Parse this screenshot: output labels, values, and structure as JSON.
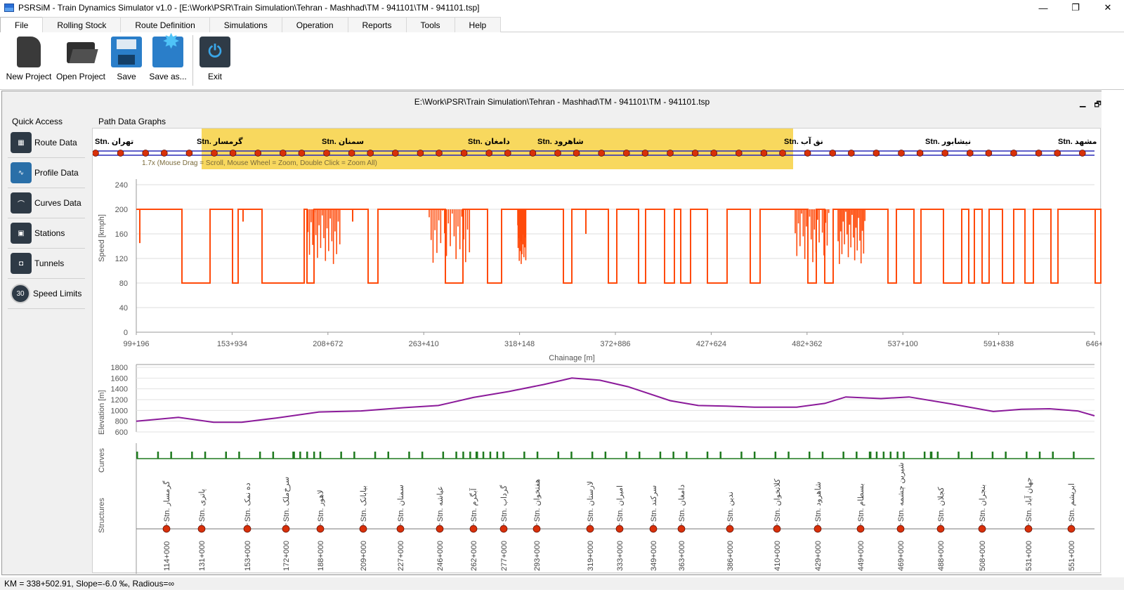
{
  "window": {
    "title": "PSRSiM - Train Dynamics Simulator v1.0 - [E:\\Work\\PSR\\Train Simulation\\Tehran - Mashhad\\TM - 941101\\TM - 941101.tsp]",
    "minimize": "—",
    "maximize": "❐",
    "close": "✕"
  },
  "menu": [
    "File",
    "Rolling Stock",
    "Route Definition",
    "Simulations",
    "Operation",
    "Reports",
    "Tools",
    "Help"
  ],
  "ribbon": {
    "new_project": "New Project",
    "open_project": "Open Project",
    "save": "Save",
    "save_as": "Save as...",
    "exit": "Exit"
  },
  "document": {
    "title": "E:\\Work\\PSR\\Train Simulation\\Tehran - Mashhad\\TM - 941101\\TM - 941101.tsp",
    "btn_min": "▁",
    "btn_restore": "🗗",
    "btn_close": "✕"
  },
  "quick_access": {
    "label": "Quick Access",
    "items": [
      "Route Data",
      "Profile Data",
      "Curves Data",
      "Stations",
      "Tunnels",
      "Speed Limits"
    ]
  },
  "graphs_label": "Path Data Graphs",
  "overview": {
    "hint": "1.7x (Mouse Drag = Scroll, Mouse Wheel = Zoom, Double Click = Zoom All)",
    "stations": [
      {
        "name": "Stn. تهران"
      },
      {
        "name": "Stn. گرمسار"
      },
      {
        "name": "Stn. سمنان"
      },
      {
        "name": "Stn. دامغان"
      },
      {
        "name": "Stn. شاهرود"
      },
      {
        "name": "Stn. نق آب"
      },
      {
        "name": "Stn. نیشابور"
      },
      {
        "name": "Stn. مشهد"
      }
    ]
  },
  "speed_chart": {
    "ylabel": "Speed [kmph]",
    "xlabel": "Chainage [m]",
    "yticks": [
      "240",
      "200",
      "160",
      "120",
      "80",
      "40",
      "0"
    ],
    "xticks": [
      "99+196",
      "153+934",
      "208+672",
      "263+410",
      "318+148",
      "372+886",
      "427+624",
      "482+362",
      "537+100",
      "591+838",
      "646+"
    ]
  },
  "elevation_chart": {
    "ylabel": "Elevation [m]",
    "yticks": [
      "1800",
      "1600",
      "1400",
      "1200",
      "1000",
      "800",
      "600"
    ]
  },
  "curves_label": "Curves",
  "structures_label": "Structures",
  "structures": [
    {
      "name": "Stn. گرمسار",
      "km": "114+000"
    },
    {
      "name": "Stn. پاتری",
      "km": "131+000"
    },
    {
      "name": "Stn. ده نمک",
      "km": "153+000"
    },
    {
      "name": "Stn. سرخ‌ملک",
      "km": "172+000"
    },
    {
      "name": "Stn. لاهور",
      "km": "188+000"
    },
    {
      "name": "Stn. بیابانک",
      "km": "209+000"
    },
    {
      "name": "Stn. سمنان",
      "km": "227+000"
    },
    {
      "name": "Stn. عیاشه",
      "km": "246+000"
    },
    {
      "name": "Stn. آبگرم",
      "km": "262+000"
    },
    {
      "name": "Stn. گرداب",
      "km": "277+000"
    },
    {
      "name": "Stn. هفتخوان",
      "km": "293+000"
    },
    {
      "name": "Stn. لارستان",
      "km": "319+000"
    },
    {
      "name": "Stn. امیران",
      "km": "333+000"
    },
    {
      "name": "Stn. سرکند",
      "km": "349+000"
    },
    {
      "name": "Stn. دامغان",
      "km": "363+000"
    },
    {
      "name": "Stn. ندین",
      "km": "386+000"
    },
    {
      "name": "Stn. کلاتخوان",
      "km": "410+000"
    },
    {
      "name": "Stn. شاهرود",
      "km": "429+000"
    },
    {
      "name": "Stn. بسطام",
      "km": "449+000"
    },
    {
      "name": "Stn. شیرین چشمه",
      "km": "469+000"
    },
    {
      "name": "Stn. کجلان",
      "km": "488+000"
    },
    {
      "name": "Stn. بنجران",
      "km": "508+000"
    },
    {
      "name": "Stn. جهان آباد",
      "km": "531+000"
    },
    {
      "name": "Stn. ابریشم",
      "km": "551+000"
    }
  ],
  "status": "KM = 338+502.91, Slope=-6.0 ‰, Radious=∞",
  "colors": {
    "speed": "#ff4a0a",
    "elevation": "#8b1a9a",
    "curves": "#1f7a1f",
    "station_dot": "#d8300a",
    "overview_line": "#2a2ab8",
    "overview_highlight": "#f7d44c"
  }
}
